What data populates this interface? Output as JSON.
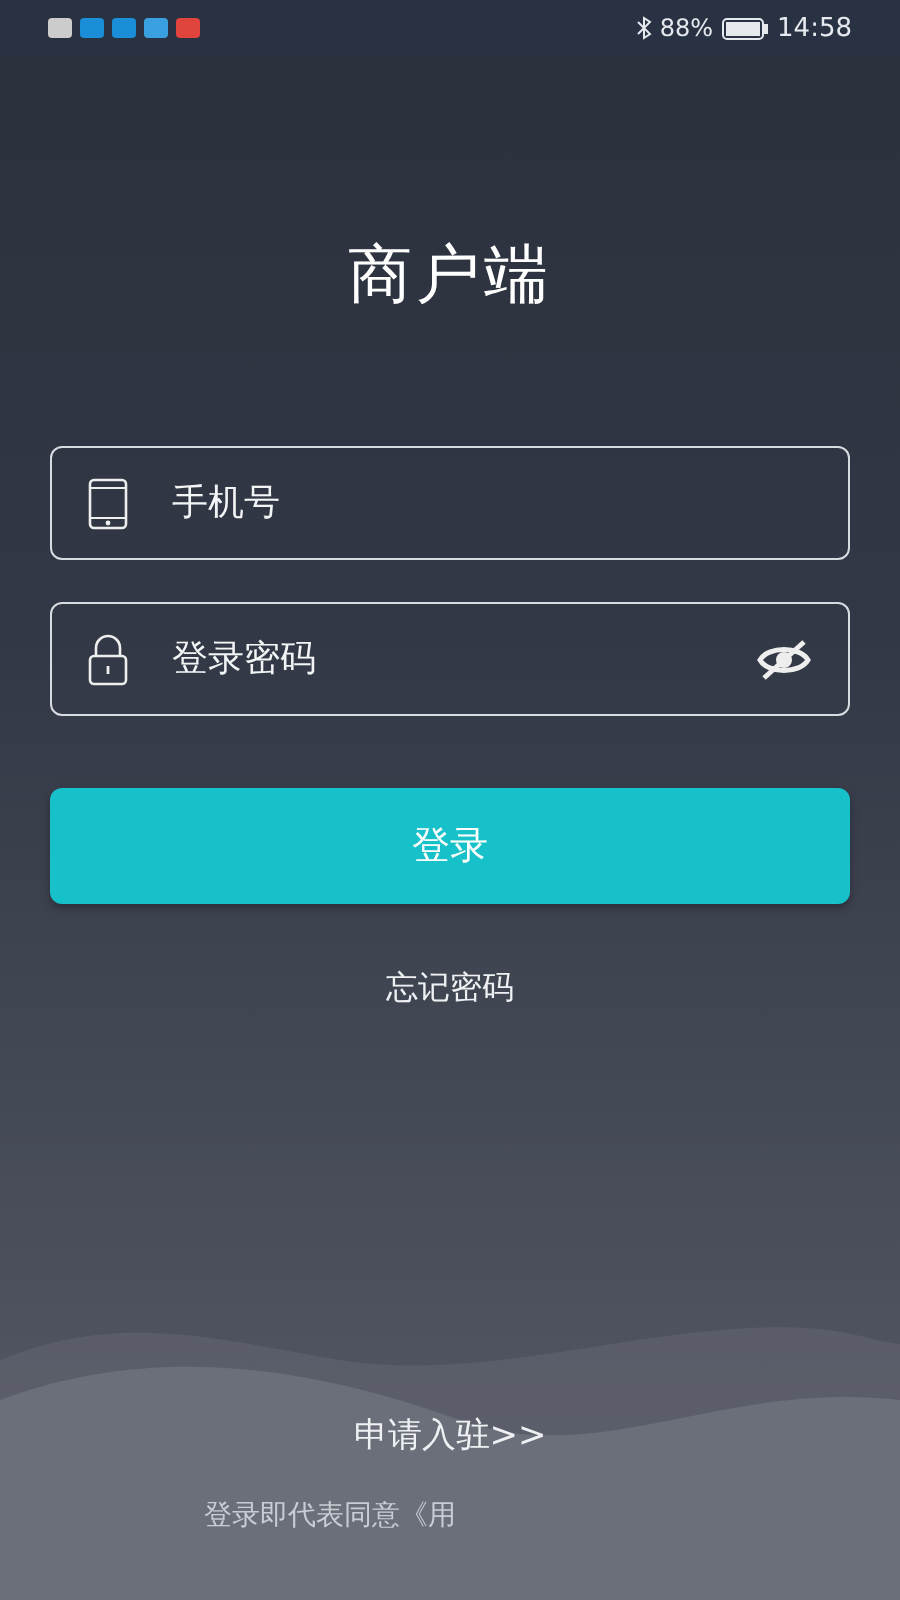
{
  "status_bar": {
    "battery_text": "88%",
    "time": "14:58"
  },
  "title": "商户端",
  "fields": [
    {
      "kind": "phone",
      "placeholder": "手机号"
    },
    {
      "kind": "password",
      "placeholder": "登录密码",
      "password_visible": false
    }
  ],
  "login_button": "登录",
  "forgot_link": "忘记密码",
  "apply_link": "申请入驻>>",
  "agreement": "登录即代表同意《用"
}
